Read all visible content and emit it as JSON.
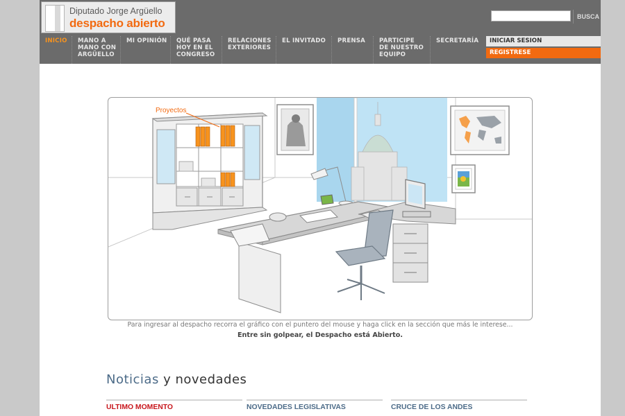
{
  "logo": {
    "line1": "Diputado Jorge Argüello",
    "line2": "despacho abierto"
  },
  "search": {
    "button_label": "BUSCA",
    "value": ""
  },
  "nav": {
    "items": [
      {
        "label": "INICIO"
      },
      {
        "label": "MANO A\nMANO CON\nARGÜELLO"
      },
      {
        "label": "MI OPINIÓN"
      },
      {
        "label": "QUÉ PASA\nHOY EN EL\nCONGRESO"
      },
      {
        "label": "RELACIONES\nEXTERIORES"
      },
      {
        "label": "EL INVITADO"
      },
      {
        "label": "PRENSA"
      },
      {
        "label": "PARTICIPE\nDE NUESTRO\nEQUIPO"
      },
      {
        "label": "SECRETARÍA"
      }
    ]
  },
  "account": {
    "login_label": "INICIAR SESION",
    "register_label": "REGISTRESE"
  },
  "illustration": {
    "hotspot_label": "Proyectos"
  },
  "caption": "Para ingresar al despacho recorra el gráfico con el puntero del mouse y haga click en la sección que más le interese...",
  "tagline": "Entre sin golpear, el Despacho está Abierto.",
  "news": {
    "title_part1": "Noticias",
    "title_part2": "y novedades",
    "columns": [
      {
        "label": "ULTIMO MOMENTO"
      },
      {
        "label": "NOVEDADES LEGISLATIVAS"
      },
      {
        "label": "CRUCE DE LOS ANDES"
      }
    ]
  },
  "colors": {
    "header_bg": "#6b6b6b",
    "accent_orange": "#f26a10",
    "nav_active": "#f7931e",
    "link_blue": "#4c6b88",
    "alert_red": "#c8181e"
  }
}
